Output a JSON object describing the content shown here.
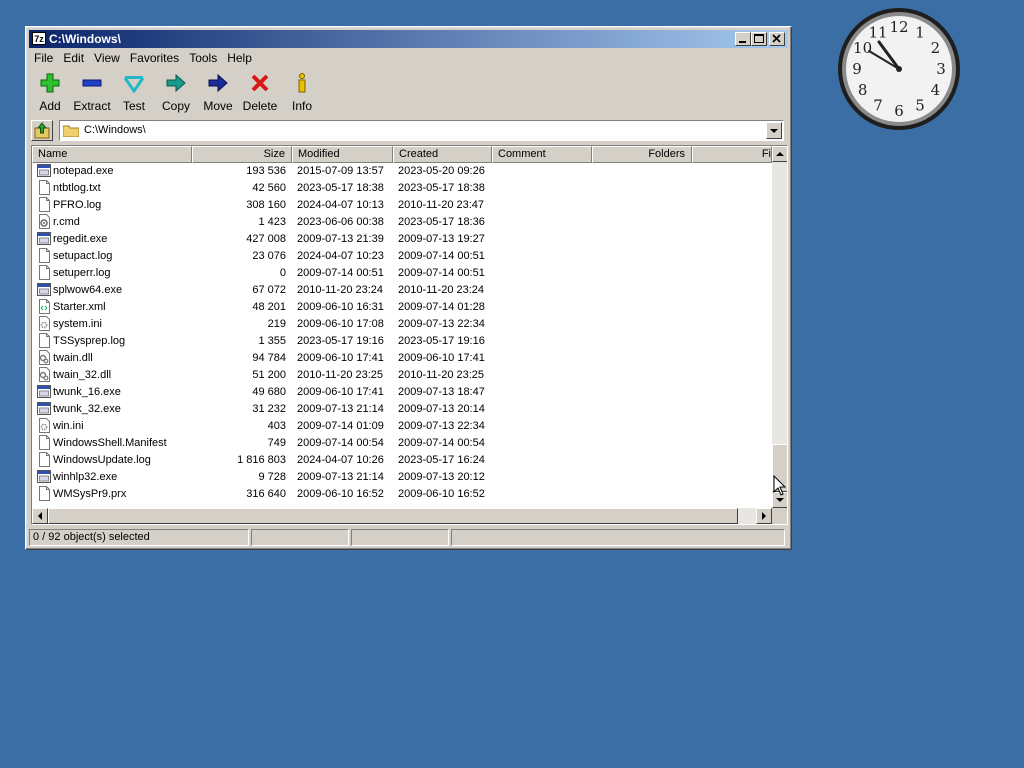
{
  "window": {
    "title": "C:\\Windows\\",
    "app_icon": "7z"
  },
  "menu": [
    "File",
    "Edit",
    "View",
    "Favorites",
    "Tools",
    "Help"
  ],
  "toolbar": [
    {
      "label": "Add",
      "icon": "add-icon"
    },
    {
      "label": "Extract",
      "icon": "extract-icon"
    },
    {
      "label": "Test",
      "icon": "test-icon"
    },
    {
      "label": "Copy",
      "icon": "copy-icon"
    },
    {
      "label": "Move",
      "icon": "move-icon"
    },
    {
      "label": "Delete",
      "icon": "delete-icon"
    },
    {
      "label": "Info",
      "icon": "info-icon"
    }
  ],
  "address": {
    "path": "C:\\Windows\\"
  },
  "columns": [
    "Name",
    "Size",
    "Modified",
    "Created",
    "Comment",
    "Folders",
    "Fi"
  ],
  "files": [
    {
      "name": "notepad.exe",
      "size": "193 536",
      "modified": "2015-07-09 13:57",
      "created": "2023-05-20 09:26",
      "type": "exe"
    },
    {
      "name": "ntbtlog.txt",
      "size": "42 560",
      "modified": "2023-05-17 18:38",
      "created": "2023-05-17 18:38",
      "type": "txt"
    },
    {
      "name": "PFRO.log",
      "size": "308 160",
      "modified": "2024-04-07 10:13",
      "created": "2010-11-20 23:47",
      "type": "txt"
    },
    {
      "name": "r.cmd",
      "size": "1 423",
      "modified": "2023-06-06 00:38",
      "created": "2023-05-17 18:36",
      "type": "cmd"
    },
    {
      "name": "regedit.exe",
      "size": "427 008",
      "modified": "2009-07-13 21:39",
      "created": "2009-07-13 19:27",
      "type": "exe"
    },
    {
      "name": "setupact.log",
      "size": "23 076",
      "modified": "2024-04-07 10:23",
      "created": "2009-07-14 00:51",
      "type": "txt"
    },
    {
      "name": "setuperr.log",
      "size": "0",
      "modified": "2009-07-14 00:51",
      "created": "2009-07-14 00:51",
      "type": "txt"
    },
    {
      "name": "splwow64.exe",
      "size": "67 072",
      "modified": "2010-11-20 23:24",
      "created": "2010-11-20 23:24",
      "type": "exe"
    },
    {
      "name": "Starter.xml",
      "size": "48 201",
      "modified": "2009-06-10 16:31",
      "created": "2009-07-14 01:28",
      "type": "xml"
    },
    {
      "name": "system.ini",
      "size": "219",
      "modified": "2009-06-10 17:08",
      "created": "2009-07-13 22:34",
      "type": "ini"
    },
    {
      "name": "TSSysprep.log",
      "size": "1 355",
      "modified": "2023-05-17 19:16",
      "created": "2023-05-17 19:16",
      "type": "txt"
    },
    {
      "name": "twain.dll",
      "size": "94 784",
      "modified": "2009-06-10 17:41",
      "created": "2009-06-10 17:41",
      "type": "dll"
    },
    {
      "name": "twain_32.dll",
      "size": "51 200",
      "modified": "2010-11-20 23:25",
      "created": "2010-11-20 23:25",
      "type": "dll"
    },
    {
      "name": "twunk_16.exe",
      "size": "49 680",
      "modified": "2009-06-10 17:41",
      "created": "2009-07-13 18:47",
      "type": "exe"
    },
    {
      "name": "twunk_32.exe",
      "size": "31 232",
      "modified": "2009-07-13 21:14",
      "created": "2009-07-13 20:14",
      "type": "exe"
    },
    {
      "name": "win.ini",
      "size": "403",
      "modified": "2009-07-14 01:09",
      "created": "2009-07-13 22:34",
      "type": "ini"
    },
    {
      "name": "WindowsShell.Manifest",
      "size": "749",
      "modified": "2009-07-14 00:54",
      "created": "2009-07-14 00:54",
      "type": "txt"
    },
    {
      "name": "WindowsUpdate.log",
      "size": "1 816 803",
      "modified": "2024-04-07 10:26",
      "created": "2023-05-17 16:24",
      "type": "txt"
    },
    {
      "name": "winhlp32.exe",
      "size": "9 728",
      "modified": "2009-07-13 21:14",
      "created": "2009-07-13 20:12",
      "type": "exe"
    },
    {
      "name": "WMSysPr9.prx",
      "size": "316 640",
      "modified": "2009-06-10 16:52",
      "created": "2009-06-10 16:52",
      "type": "txt"
    }
  ],
  "status": {
    "selection": "0 / 92 object(s) selected"
  },
  "clock": {
    "numerals": [
      "12",
      "1",
      "2",
      "3",
      "4",
      "5",
      "6",
      "7",
      "8",
      "9",
      "10",
      "11"
    ]
  },
  "colors": {
    "desktop": "#3a6ea5",
    "titlebar_start": "#0a246a",
    "titlebar_end": "#a6caf0"
  }
}
